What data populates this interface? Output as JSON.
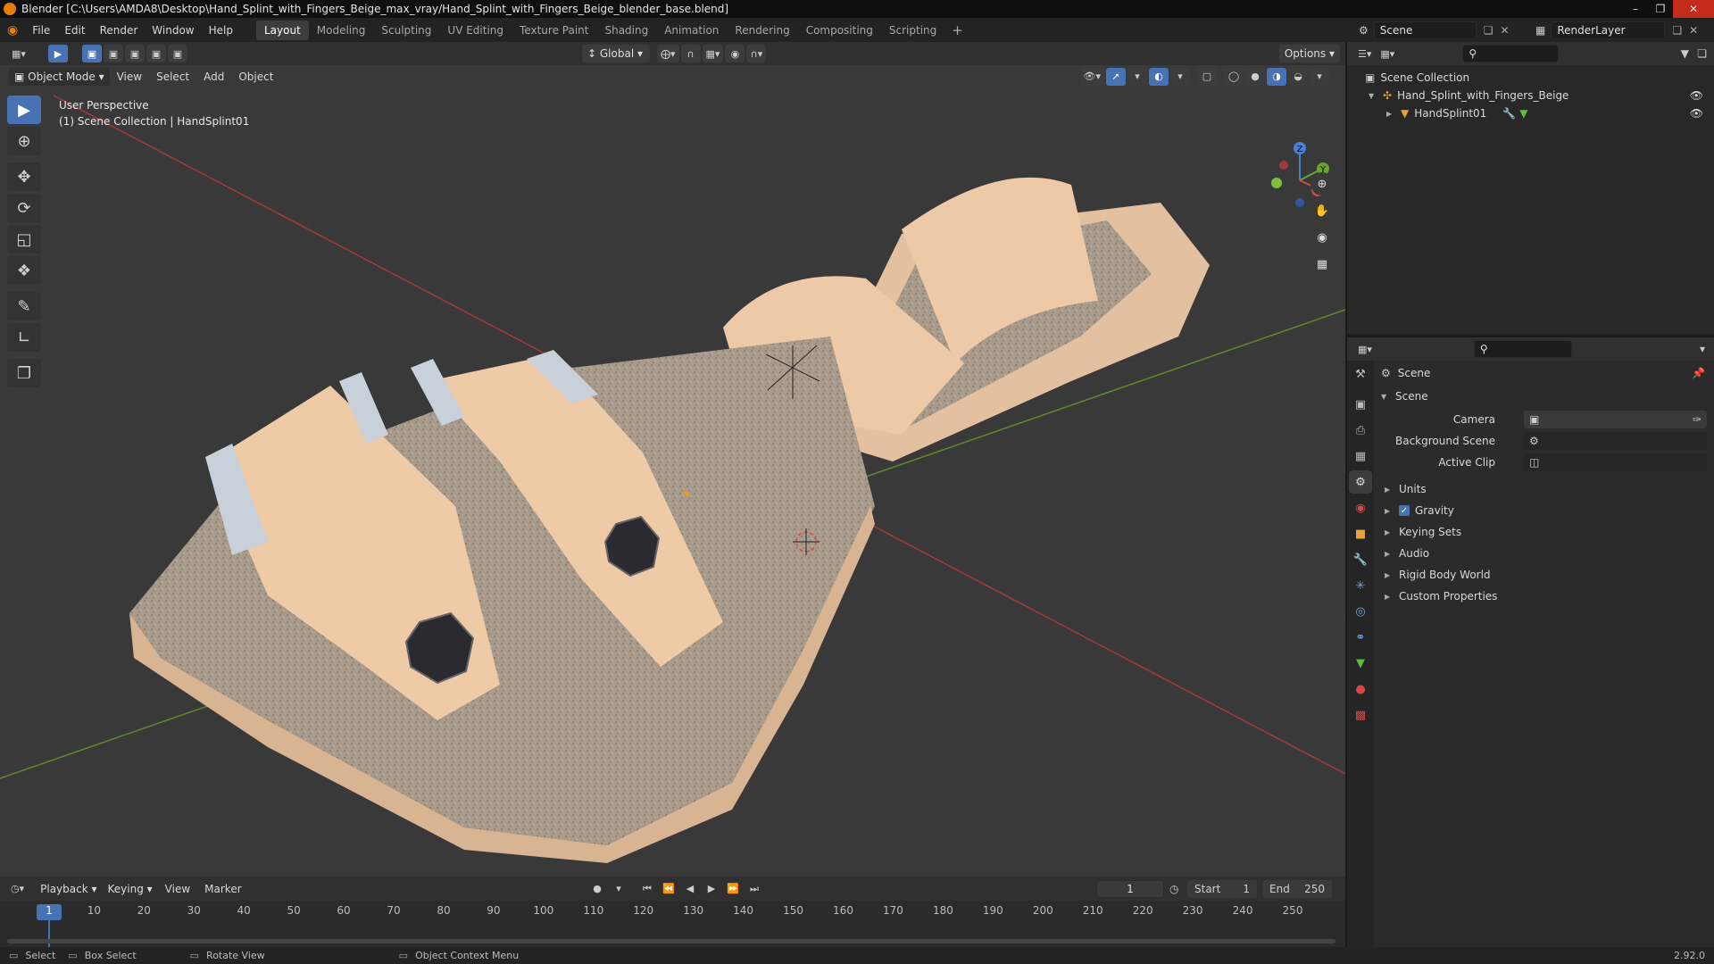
{
  "window": {
    "title": "Blender [C:\\Users\\AMDA8\\Desktop\\Hand_Splint_with_Fingers_Beige_max_vray/Hand_Splint_with_Fingers_Beige_blender_base.blend]"
  },
  "menu": {
    "items": [
      "File",
      "Edit",
      "Render",
      "Window",
      "Help"
    ],
    "workspaces": [
      "Layout",
      "Modeling",
      "Sculpting",
      "UV Editing",
      "Texture Paint",
      "Shading",
      "Animation",
      "Rendering",
      "Compositing",
      "Scripting"
    ],
    "active_workspace": "Layout",
    "scene": "Scene",
    "view_layer": "RenderLayer"
  },
  "viewport": {
    "transform_orientation": "Global",
    "options_label": "Options",
    "mode": "Object Mode",
    "menus": [
      "View",
      "Select",
      "Add",
      "Object"
    ],
    "info_line1": "User Perspective",
    "info_line2": "(1) Scene Collection | HandSplint01",
    "colors": {
      "background": "#393939",
      "x_axis": "#a33a3a",
      "y_axis": "#5d8a2c",
      "object": "#e8c4a0"
    }
  },
  "outliner": {
    "root": "Scene Collection",
    "items": [
      {
        "label": "Hand_Splint_with_Fingers_Beige",
        "icon": "empty-icon"
      },
      {
        "label": "HandSplint01",
        "icon": "mesh-icon"
      }
    ]
  },
  "properties": {
    "context": "Scene",
    "panel_title": "Scene",
    "fields": [
      {
        "label": "Camera",
        "value": ""
      },
      {
        "label": "Background Scene",
        "value": ""
      },
      {
        "label": "Active Clip",
        "value": ""
      }
    ],
    "subpanels": [
      "Units",
      "Gravity",
      "Keying Sets",
      "Audio",
      "Rigid Body World",
      "Custom Properties"
    ],
    "gravity_checked": true
  },
  "timeline": {
    "menus": [
      "Playback",
      "Keying",
      "View",
      "Marker"
    ],
    "current_frame": "1",
    "start_label": "Start",
    "start_value": "1",
    "end_label": "End",
    "end_value": "250",
    "ticks": [
      "1",
      "10",
      "20",
      "30",
      "40",
      "50",
      "60",
      "70",
      "80",
      "90",
      "100",
      "110",
      "120",
      "130",
      "140",
      "150",
      "160",
      "170",
      "180",
      "190",
      "200",
      "210",
      "220",
      "230",
      "240",
      "250"
    ]
  },
  "statusbar": {
    "select": "Select",
    "box_select": "Box Select",
    "rotate_view": "Rotate View",
    "context_menu": "Object Context Menu",
    "version": "2.92.0"
  }
}
